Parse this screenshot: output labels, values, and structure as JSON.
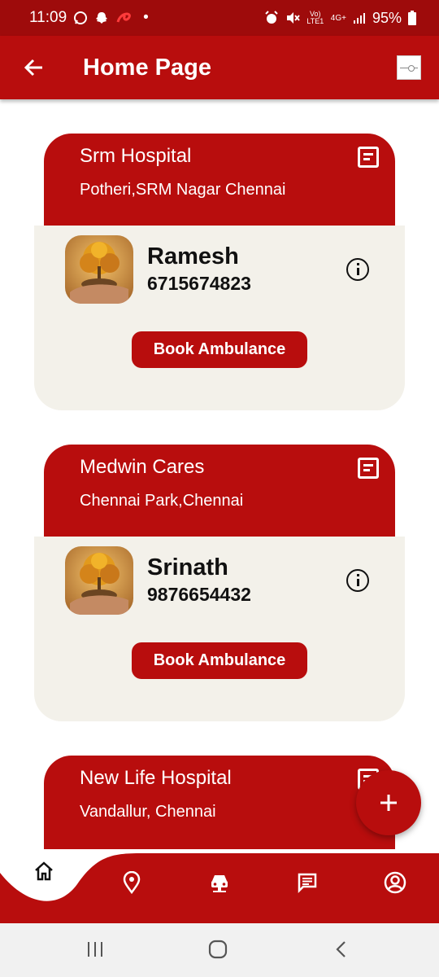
{
  "status_bar": {
    "time": "11:09",
    "dot": "•",
    "network": "Vo) LTE1",
    "net_type": "4G+",
    "battery": "95%"
  },
  "app_bar": {
    "title": "Home Page"
  },
  "hospitals": [
    {
      "name": "Srm Hospital",
      "address": "Potheri,SRM Nagar Chennai",
      "driver_name": "Ramesh",
      "driver_phone": "6715674823",
      "book_label": "Book Ambulance"
    },
    {
      "name": "Medwin Cares",
      "address": "Chennai Park,Chennai",
      "driver_name": "Srinath",
      "driver_phone": "9876654432",
      "book_label": "Book Ambulance"
    },
    {
      "name": "New Life Hospital",
      "address": "Vandallur, Chennai"
    }
  ],
  "icons": {
    "back": "arrow-left-icon",
    "menu": "menu-toggle-icon",
    "document": "document-icon",
    "info": "info-icon",
    "add": "plus-icon",
    "home": "home-icon",
    "location": "location-pin-icon",
    "ambulance": "car-icon",
    "chat": "chat-icon",
    "profile": "account-circle-icon"
  },
  "colors": {
    "primary": "#b80d0d",
    "status_bar": "#9e0b0b",
    "card_body": "#f3f1ea"
  },
  "bottom_nav": {
    "active": "home",
    "items": [
      "home",
      "location",
      "ambulance",
      "chat",
      "profile"
    ]
  }
}
